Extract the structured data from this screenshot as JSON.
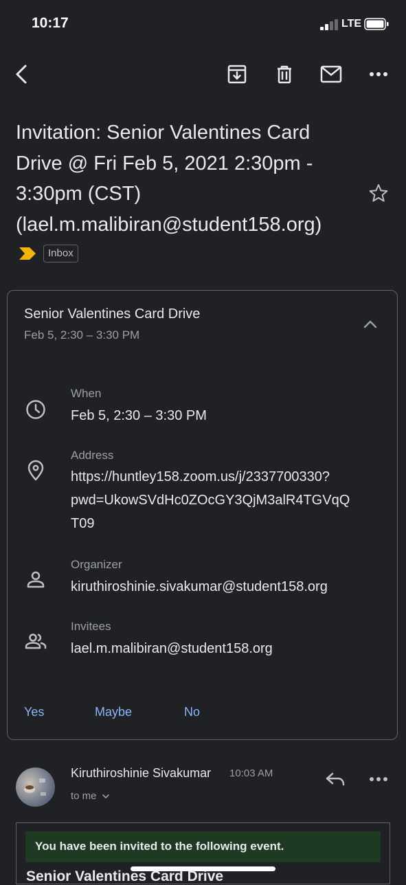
{
  "status_bar": {
    "time": "10:17",
    "network": "LTE"
  },
  "toolbar": {
    "back_icon": "back-arrow-icon",
    "archive_icon": "archive-icon",
    "delete_icon": "trash-icon",
    "mark_unread_icon": "mail-icon",
    "more_icon": "more-horiz-icon"
  },
  "email": {
    "subject_lines": [
      "Invitation: Senior Valentines Card",
      "Drive @ Fri Feb 5, 2021 2:30pm -",
      "3:30pm (CST)",
      "(lael.m.malibiran@student158.org)"
    ],
    "label": "Inbox",
    "importance_color": "#f4b400"
  },
  "event_card": {
    "title": "Senior Valentines Card Drive",
    "date": "Feb 5, 2:30 – 3:30 PM",
    "when": {
      "label": "When",
      "value": "Feb 5, 2:30 – 3:30 PM"
    },
    "address": {
      "label": "Address",
      "lines": [
        "https://huntley158.zoom.us/j/2337700330?",
        "pwd=UkowSVdHc0ZOcGY3QjM3alR4TGVqQ",
        "T09"
      ]
    },
    "organizer": {
      "label": "Organizer",
      "value": "kiruthiroshinie.sivakumar@student158.org"
    },
    "invitees": {
      "label": "Invitees",
      "value": "lael.m.malibiran@student158.org"
    },
    "rsvp": {
      "yes": "Yes",
      "maybe": "Maybe",
      "no": "No"
    }
  },
  "message": {
    "sender": "Kiruthiroshinie Sivakumar",
    "time": "10:03 AM",
    "to": "to me",
    "banner": "You have been invited to the following event.",
    "body_title": "Senior Valentines Card Drive"
  },
  "colors": {
    "background": "#202124",
    "link": "#8ab4f8",
    "banner": "#1e3a22"
  }
}
